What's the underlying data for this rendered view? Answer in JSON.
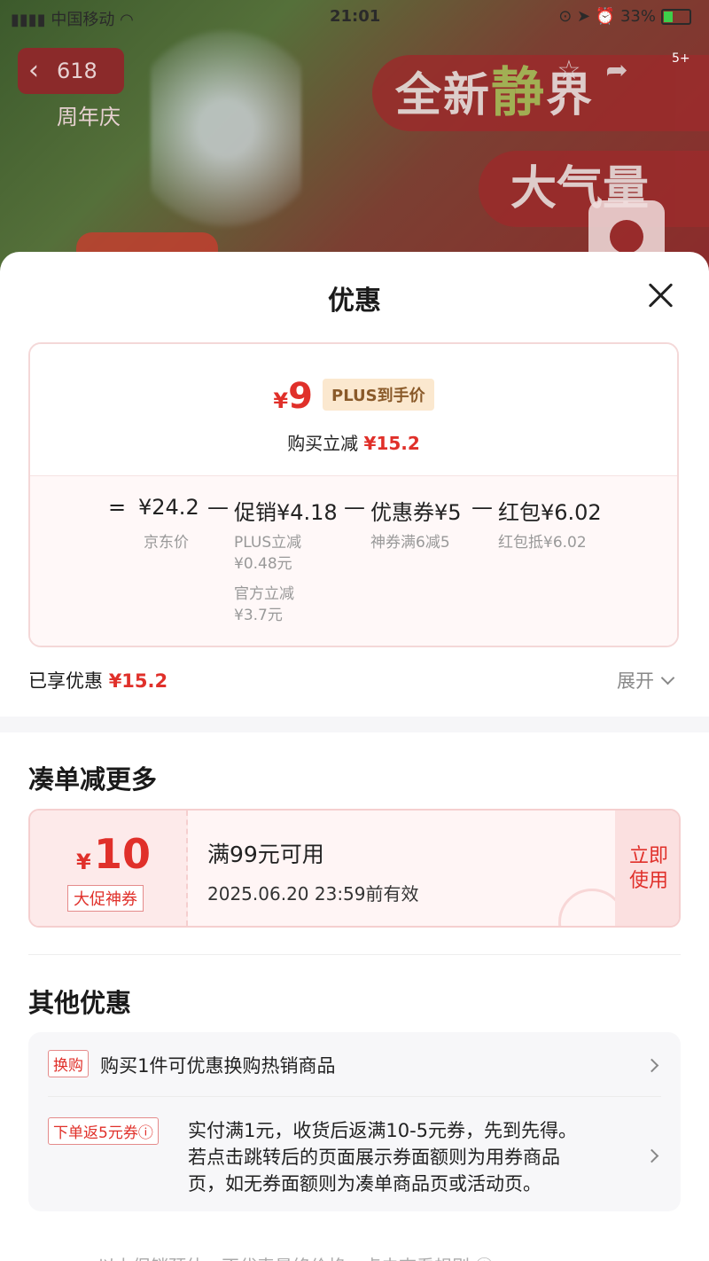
{
  "status_bar": {
    "carrier": "中国移动",
    "time": "21:01",
    "battery": "33%"
  },
  "background": {
    "badge": "618 周年庆",
    "promo_line1_a": "全新",
    "promo_line1_b": "静",
    "promo_line1_c": "界",
    "promo_line2": "大气量",
    "message_count": "5+"
  },
  "sheet": {
    "title": "优惠",
    "price_card": {
      "currency": "¥",
      "final_price": "9",
      "plus_tag": "PLUS到手价",
      "instant_label": "购买立减",
      "instant_value": "¥15.2",
      "calc": {
        "equals": "=",
        "jd_price": "¥24.2",
        "jd_price_label": "京东价",
        "minus": "—",
        "promo": "促销¥4.18",
        "promo_sub1_a": "PLUS立减",
        "promo_sub1_b": "¥0.48元",
        "promo_sub2_a": "官方立减",
        "promo_sub2_b": "¥3.7元",
        "coupon": "优惠券¥5",
        "coupon_sub": "神券满6减5",
        "redpacket": "红包¥6.02",
        "redpacket_sub": "红包抵¥6.02"
      }
    },
    "enjoyed_label": "已享优惠",
    "enjoyed_value": "¥15.2",
    "expand_label": "展开",
    "bundle_title": "凑单减更多",
    "coupon": {
      "currency": "¥",
      "amount": "10",
      "tag": "大促神券",
      "condition": "满99元可用",
      "validity": "2025.06.20 23:59前有效",
      "use_line1": "立即",
      "use_line2": "使用"
    },
    "other_title": "其他优惠",
    "other_items": [
      {
        "tag": "换购",
        "text": "购买1件可优惠换购热销商品"
      },
      {
        "tag": "下单返5元券ⓘ",
        "text_line1": "实付满1元，收货后返满10-5元券，先到先得。",
        "text_line2": "若点击跳转后的页面展示券面额则为用券商品",
        "text_line3": "页，如无券面额则为凑单商品页或活动页。"
      }
    ],
    "footer": "以上促销预估，不代表最终价格，点击查看规则 ⓘ"
  }
}
